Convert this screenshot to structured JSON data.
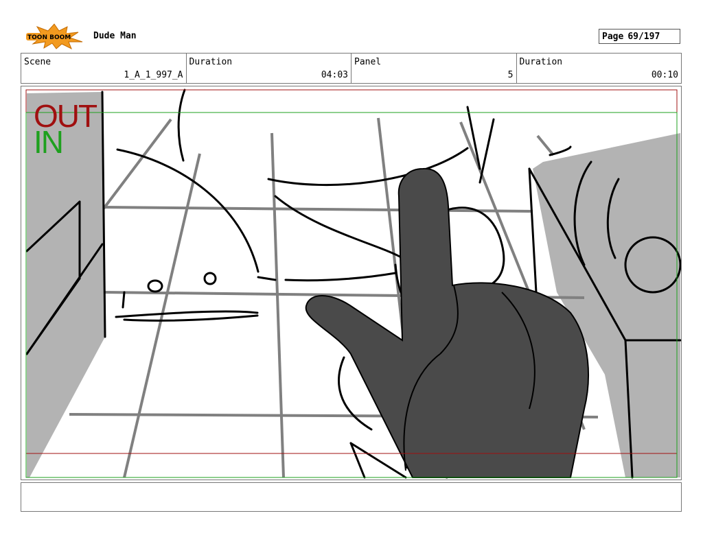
{
  "header": {
    "project_title": "Dude Man",
    "page_label": "Page",
    "page_value": "69/197",
    "logo_text": "TOON BOOM"
  },
  "info": {
    "scene_label": "Scene",
    "scene_value": "1_A_1_997_A",
    "scene_duration_label": "Duration",
    "scene_duration_value": "04:03",
    "panel_label": "Panel",
    "panel_value": "5",
    "panel_duration_label": "Duration",
    "panel_duration_value": "00:10"
  },
  "panel": {
    "out_label": "OUT",
    "in_label": "IN",
    "out_color": "#a01010",
    "in_color": "#1ea01e",
    "hand_color": "#4a4a4a",
    "wall_color": "#b3b3b3"
  },
  "notes": {
    "text": ""
  }
}
